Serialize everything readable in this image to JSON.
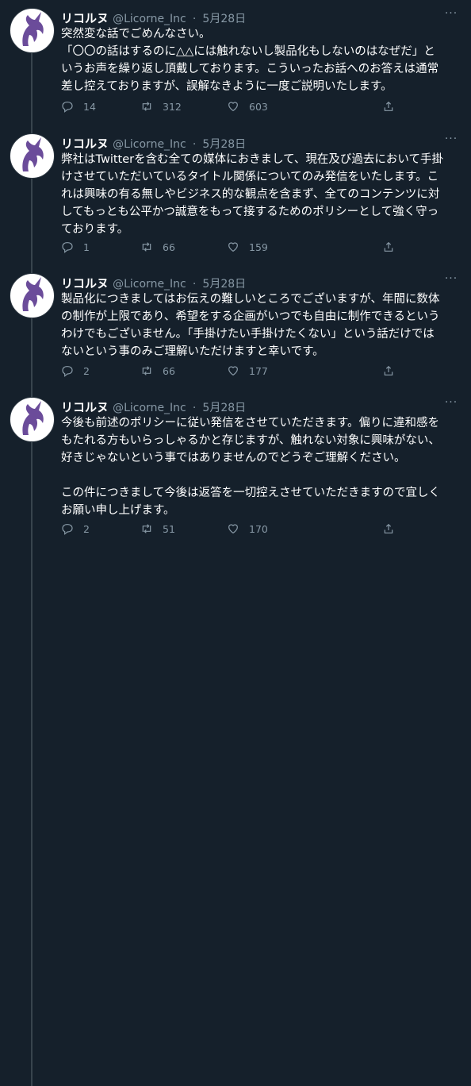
{
  "colors": {
    "background": "#15202b",
    "text": "#ffffff",
    "muted": "#8899a6",
    "avatar_purple": "#6b4c9a"
  },
  "tweets": [
    {
      "name": "リコルヌ",
      "handle": "@Licorne_Inc",
      "separator": "·",
      "time": "5月28日",
      "text": "突然変な話でごめんなさい。\n「〇〇の話はするのに△△には触れないし製品化もしないのはなぜだ」と\nいうお声を繰り返し頂戴しております。こういったお話へのお答えは通常\n差し控えておりますが、誤解なきように一度ご説明いたします。",
      "replies": "14",
      "retweets": "312",
      "likes": "603"
    },
    {
      "name": "リコルヌ",
      "handle": "@Licorne_Inc",
      "separator": "·",
      "time": "5月28日",
      "text": "弊社はTwitterを含む全ての媒体におきまして、現在及び過去において手掛\nけさせていただいているタイトル関係についてのみ発信をいたします。こ\nれは興味の有る無しやビジネス的な観点を含まず、全てのコンテンツに対\nしてもっとも公平かつ誠意をもって接するためのポリシーとして強く守っ\nております。",
      "replies": "1",
      "retweets": "66",
      "likes": "159"
    },
    {
      "name": "リコルヌ",
      "handle": "@Licorne_Inc",
      "separator": "·",
      "time": "5月28日",
      "text": "製品化につきましてはお伝えの難しいところでございますが、年間に数体\nの制作が上限であり、希望をする企画がいつでも自由に制作できるという\nわけでもございません。「手掛けたい手掛けたくない」という話だけでは\nないという事のみご理解いただけますと幸いです。",
      "replies": "2",
      "retweets": "66",
      "likes": "177"
    },
    {
      "name": "リコルヌ",
      "handle": "@Licorne_Inc",
      "separator": "·",
      "time": "5月28日",
      "text": "今後も前述のポリシーに従い発信をさせていただきます。偏りに違和感を\nもたれる方もいらっしゃるかと存じますが、触れない対象に興味がない、\n好きじゃないという事ではありませんのでどうぞご理解ください。\n\nこの件につきまして今後は返答を一切控えさせていただきますので宜しく\nお願い申し上げます。",
      "replies": "2",
      "retweets": "51",
      "likes": "170"
    }
  ]
}
